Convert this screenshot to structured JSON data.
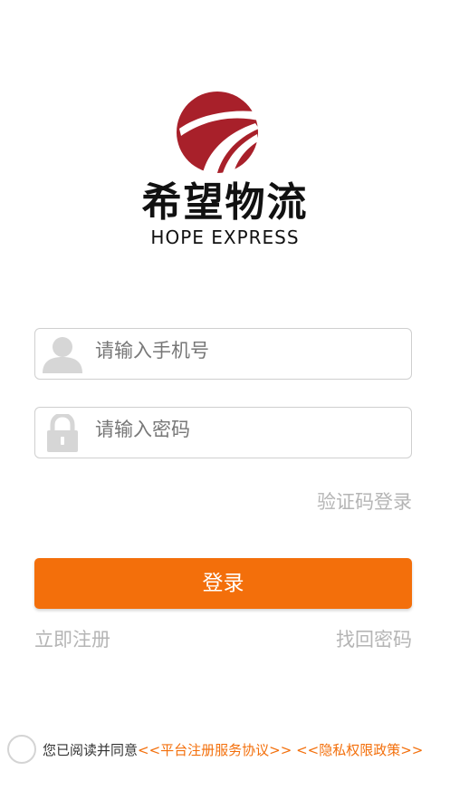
{
  "brand": {
    "name": "希望物流",
    "subtitle": "HOPE EXPRESS",
    "logo_icon": "hope-express-logo-icon",
    "logo_color": "#a8202a"
  },
  "form": {
    "phone": {
      "icon": "user-icon",
      "placeholder": "请输入手机号",
      "value": ""
    },
    "password": {
      "icon": "lock-icon",
      "placeholder": "请输入密码",
      "value": ""
    }
  },
  "links": {
    "sms_login": "验证码登录",
    "register": "立即注册",
    "forgot_password": "找回密码"
  },
  "login_button": {
    "label": "登录",
    "color": "#f36f0b"
  },
  "agreement": {
    "checked": false,
    "prefix": "您已阅读并同意",
    "service_link": "<<平台注册服务协议>>",
    "privacy_link": "<<隐私权限政策>>"
  }
}
